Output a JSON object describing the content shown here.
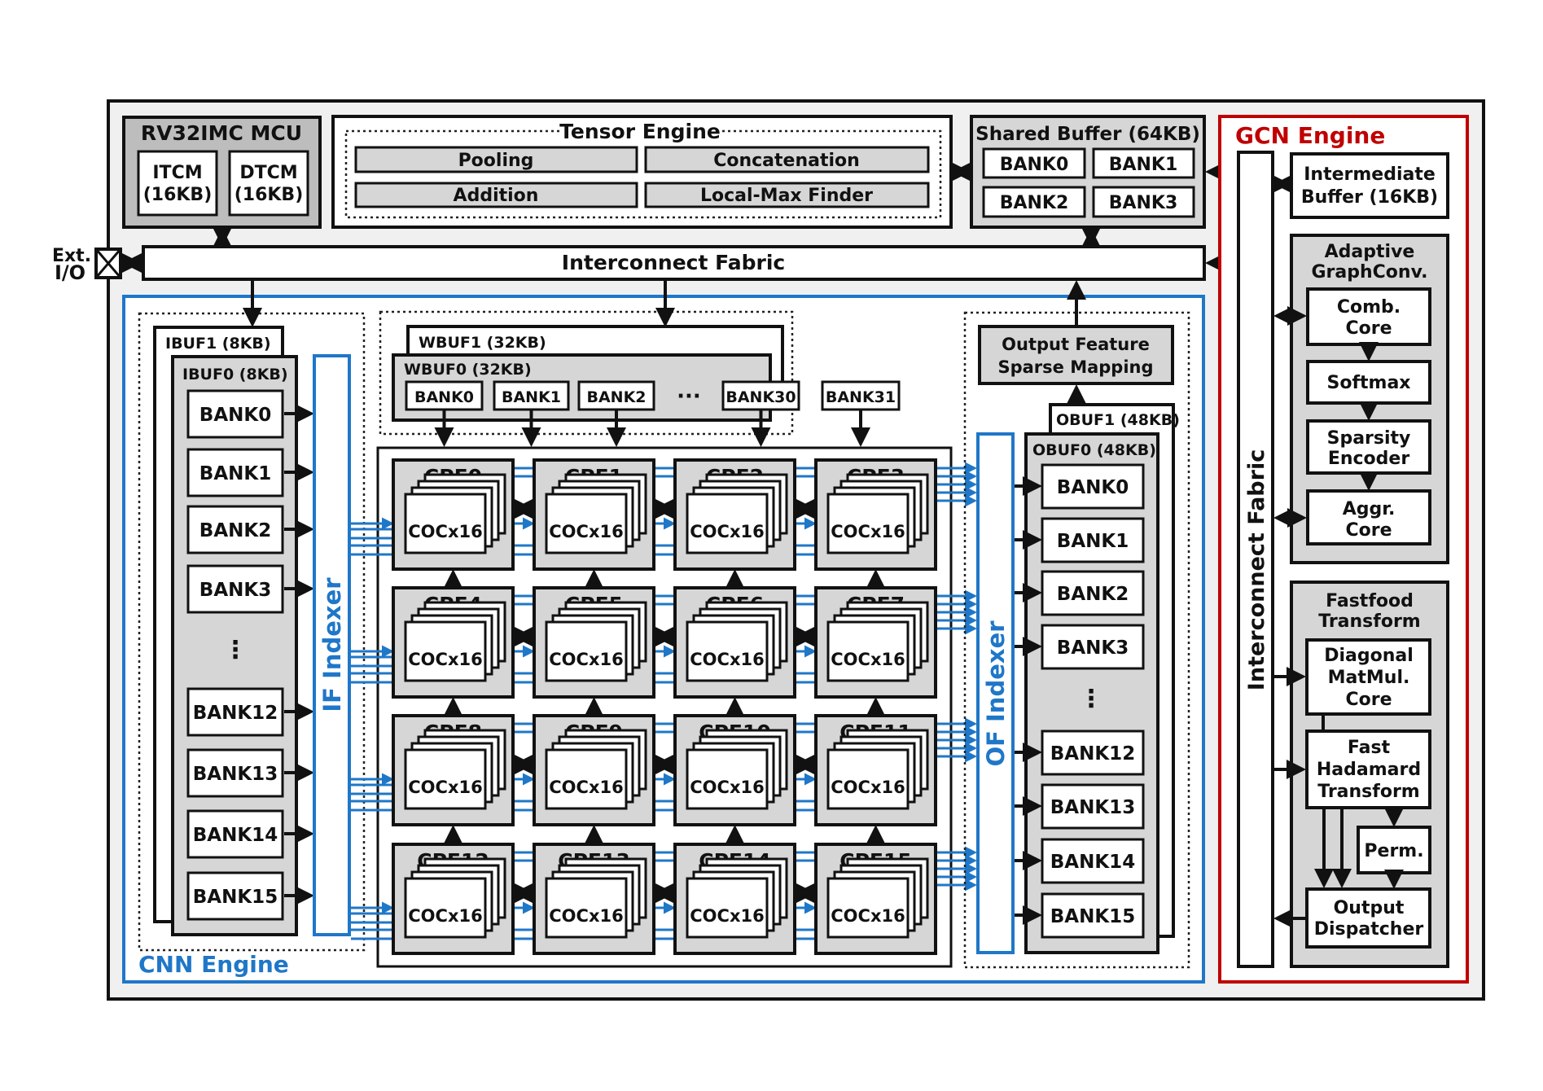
{
  "colors": {
    "cnn_engine": "#1f77c8",
    "gcn_engine": "#c00000",
    "outer_background": "#f0f0f0",
    "module_gray": "#d6d6d6",
    "mcu_gray": "#bdbdbd"
  },
  "ext_io": {
    "line1": "Ext.",
    "line2": "I/O"
  },
  "mcu": {
    "title": "RV32IMC MCU",
    "itcm": {
      "line1": "ITCM",
      "line2": "(16KB)"
    },
    "dtcm": {
      "line1": "DTCM",
      "line2": "(16KB)"
    }
  },
  "tensor_engine": {
    "title": "Tensor Engine",
    "units": [
      "Pooling",
      "Concatenation",
      "Addition",
      "Local-Max Finder"
    ]
  },
  "shared_buffer": {
    "title": "Shared Buffer (64KB)",
    "banks": [
      "BANK0",
      "BANK1",
      "BANK2",
      "BANK3"
    ]
  },
  "interconnect": {
    "label": "Interconnect Fabric"
  },
  "cnn_engine": {
    "label": "CNN Engine",
    "ibuf1": "IBUF1 (8KB)",
    "ibuf0": "IBUF0 (8KB)",
    "ibuf_banks": [
      "BANK0",
      "BANK1",
      "BANK2",
      "BANK3",
      "BANK12",
      "BANK13",
      "BANK14",
      "BANK15"
    ],
    "ibuf_ellipsis": "⋮",
    "if_indexer": "IF Indexer",
    "wbuf1": "WBUF1 (32KB)",
    "wbuf0": "WBUF0 (32KB)",
    "wbuf_banks": [
      "BANK0",
      "BANK1",
      "BANK2",
      "BANK30",
      "BANK31"
    ],
    "wbuf_ellipsis": "···",
    "cpes": [
      "CPE0",
      "CPE1",
      "CPE2",
      "CPE3",
      "CPE4",
      "CPE5",
      "CPE6",
      "CPE7",
      "CPE8",
      "CPE9",
      "CPE10",
      "CPE11",
      "CPE12",
      "CPE13",
      "CPE14",
      "CPE15"
    ],
    "coc_label": "COCx16",
    "of_indexer": "OF Indexer",
    "ofsm": {
      "line1": "Output Feature",
      "line2": "Sparse Mapping"
    },
    "obuf1": "OBUF1 (48KB)",
    "obuf0": "OBUF0 (48KB)",
    "obuf_banks": [
      "BANK0",
      "BANK1",
      "BANK2",
      "BANK3",
      "BANK12",
      "BANK13",
      "BANK14",
      "BANK15"
    ],
    "obuf_ellipsis": "⋮"
  },
  "gcn_engine": {
    "label": "GCN Engine",
    "interconnect": "Interconnect Fabric",
    "intermediate_buffer": {
      "line1": "Intermediate",
      "line2": "Buffer (16KB)"
    },
    "adaptive": {
      "title1": "Adaptive",
      "title2": "GraphConv.",
      "comb": {
        "line1": "Comb.",
        "line2": "Core"
      },
      "softmax": "Softmax",
      "sparsity": {
        "line1": "Sparsity",
        "line2": "Encoder"
      },
      "aggr": {
        "line1": "Aggr.",
        "line2": "Core"
      }
    },
    "fastfood": {
      "title1": "Fastfood",
      "title2": "Transform",
      "diagonal": {
        "line1": "Diagonal",
        "line2": "MatMul.",
        "line3": "Core"
      },
      "fht": {
        "line1": "Fast",
        "line2": "Hadamard",
        "line3": "Transform"
      },
      "perm": "Perm.",
      "dispatcher": {
        "line1": "Output",
        "line2": "Dispatcher"
      }
    }
  }
}
